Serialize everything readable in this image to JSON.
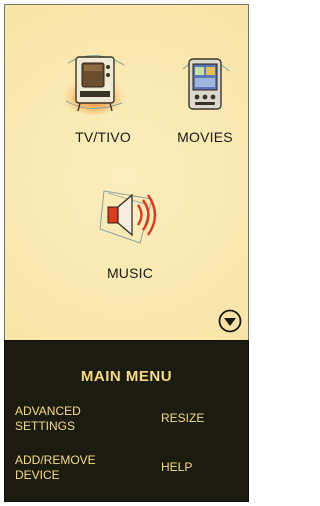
{
  "launcher": {
    "tiles": [
      {
        "id": "tv",
        "label": "TV/TIVO",
        "icon": "television-icon"
      },
      {
        "id": "movies",
        "label": "MOVIES",
        "icon": "pda-movies-icon"
      },
      {
        "id": "music",
        "label": "MUSIC",
        "icon": "speaker-icon"
      }
    ],
    "scroll_icon": "chevron-down-circle-icon"
  },
  "menu": {
    "title": "MAIN MENU",
    "items": [
      {
        "label_line1": "ADVANCED",
        "label_line2": "SETTINGS"
      },
      {
        "label_line1": "RESIZE"
      },
      {
        "label_line1": "ADD/REMOVE",
        "label_line2": "DEVICE"
      },
      {
        "label_line1": "HELP"
      }
    ]
  },
  "colors": {
    "background": "#f7e4a5",
    "menu_background": "#1c1b0f",
    "menu_text": "#f4dc86",
    "accent_red": "#d93b1c"
  }
}
